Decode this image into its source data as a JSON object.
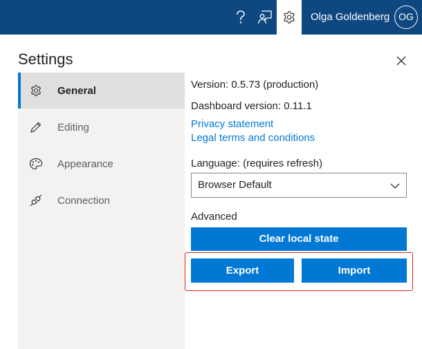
{
  "topbar": {
    "help_icon": "question-mark-icon",
    "feedback_icon": "feedback-person-icon",
    "settings_icon": "gear-icon",
    "user_name": "Olga Goldenberg",
    "avatar_initials": "OG",
    "background_color": "#0f4880"
  },
  "panel": {
    "title": "Settings",
    "close_icon": "close-icon"
  },
  "sidebar": {
    "items": [
      {
        "label": "General",
        "icon": "gear-icon",
        "active": true
      },
      {
        "label": "Editing",
        "icon": "pencil-icon",
        "active": false
      },
      {
        "label": "Appearance",
        "icon": "palette-icon",
        "active": false
      },
      {
        "label": "Connection",
        "icon": "plug-icon",
        "active": false
      }
    ]
  },
  "general": {
    "version": "Version: 0.5.73 (production)",
    "dashboard_version": "Dashboard version: 0.11.1",
    "privacy_link": "Privacy statement",
    "legal_link": "Legal terms and conditions",
    "language_label": "Language: (requires refresh)",
    "language_value": "Browser Default",
    "advanced_label": "Advanced",
    "clear_button": "Clear local state",
    "export_button": "Export",
    "import_button": "Import"
  },
  "colors": {
    "accent": "#0078d4",
    "highlight_border": "#e02424"
  }
}
